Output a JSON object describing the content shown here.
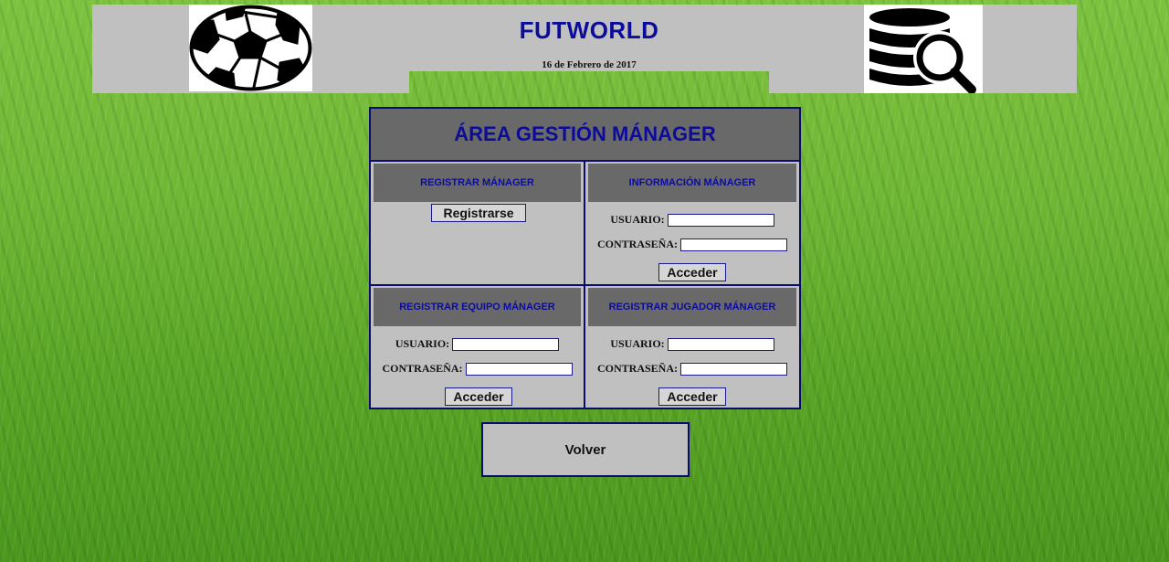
{
  "header": {
    "title": "FUTWORLD",
    "date": "16 de Febrero de 2017",
    "left_icon": "soccer-ball-icon",
    "right_icon": "database-search-icon"
  },
  "panel": {
    "title": "ÁREA GESTIÓN MÁNAGER",
    "register_manager": {
      "heading": "REGISTRAR MÁNAGER",
      "button_label": "Registrarse"
    },
    "manager_info": {
      "heading": "INFORMACIÓN MÁNAGER",
      "user_label": "USUARIO:",
      "user_value": "",
      "password_label": "CONTRASEÑA:",
      "password_value": "",
      "button_label": "Acceder"
    },
    "register_team": {
      "heading": "REGISTRAR EQUIPO MÁNAGER",
      "user_label": "USUARIO:",
      "user_value": "",
      "password_label": "CONTRASEÑA:",
      "password_value": "",
      "button_label": "Acceder"
    },
    "register_player": {
      "heading": "REGISTRAR JUGADOR MÁNAGER",
      "user_label": "USUARIO:",
      "user_value": "",
      "password_label": "CONTRASEÑA:",
      "password_value": "",
      "button_label": "Acceder"
    }
  },
  "back_button_label": "Volver",
  "colors": {
    "title_blue": "#0c0c9a",
    "panel_gray": "#c0c0c0",
    "header_dark_gray": "#696969",
    "border_navy": "#0b0b6b",
    "grass_green": "#5aa526"
  }
}
